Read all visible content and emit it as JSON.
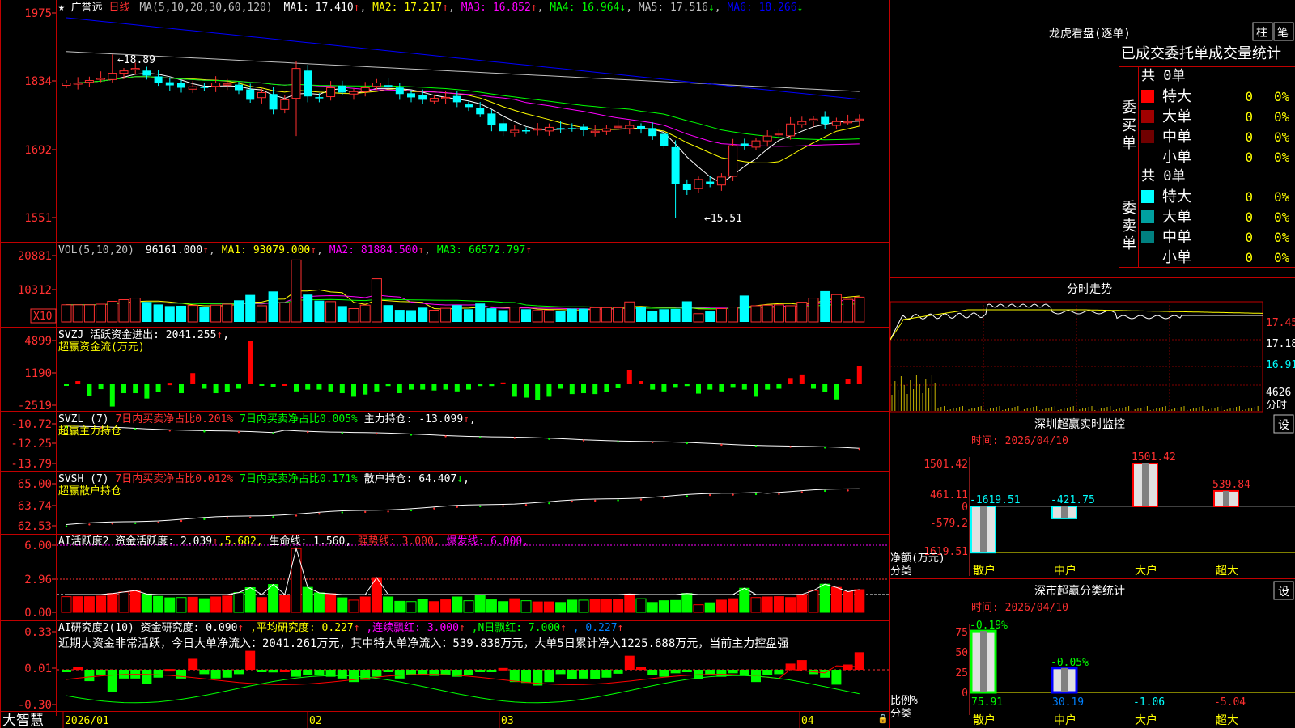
{
  "stock": {
    "star": "★",
    "name": "广誉远",
    "period": "日线"
  },
  "panels": {
    "price": {
      "yticks": [
        "1975",
        "1834",
        "1692",
        "1551"
      ],
      "ma_label": "MA(5,10,20,30,60,120)",
      "ma": [
        {
          "label": "MA1: 17.410",
          "arrow": "↑",
          "color": "#ffffff"
        },
        {
          "label": "MA2: 17.217",
          "arrow": "↑",
          "color": "#ffff00"
        },
        {
          "label": "MA3: 16.852",
          "arrow": "↑",
          "color": "#ff00ff"
        },
        {
          "label": "MA4: 16.964",
          "arrow": "↓",
          "color": "#00ff00"
        },
        {
          "label": "MA5: 17.516",
          "arrow": "↓",
          "color": "#c0c0c0"
        },
        {
          "label": "MA6: 18.266",
          "arrow": "↓",
          "color": "#0000ff"
        }
      ],
      "high_label": "←18.89",
      "low_label": "←15.51"
    },
    "vol": {
      "yticks": [
        "20881",
        "10312"
      ],
      "unit": "X10",
      "label": "VOL(5,10,20)",
      "value": "96161.000",
      "value_arrow": "↑",
      "ma": [
        {
          "label": "MA1: 93079.000",
          "arrow": "↑",
          "color": "#ffff00"
        },
        {
          "label": "MA2: 81884.500",
          "arrow": "↑",
          "color": "#ff00ff"
        },
        {
          "label": "MA3: 66572.797",
          "arrow": "↑",
          "color": "#00ff00"
        }
      ]
    },
    "svzj": {
      "yticks": [
        "4899",
        "1190",
        "-2519"
      ],
      "line1": "SVZJ  活跃资金进出: 2041.255",
      "line1_arrow": "↑",
      "line1_tail": ",",
      "line2": "超赢资金流(万元)"
    },
    "svzl": {
      "yticks": [
        "-10.72",
        "-12.25",
        "-13.79"
      ],
      "name": "SVZL (7)",
      "seg1": "7日内买卖净占比0.201%",
      "seg2": "7日内买卖净占比0.005%",
      "seg3": "主力持仓: -13.099",
      "seg3_arrow": "↑",
      "tail": ",",
      "line2": "超赢主力持仓"
    },
    "svsh": {
      "yticks": [
        "65.00",
        "63.74",
        "62.53"
      ],
      "name": "SVSH (7)",
      "seg1": "7日内买卖净占比0.012%",
      "seg2": "7日内买卖净占比0.171%",
      "seg3": "散户持仓: 64.407",
      "seg3_arrow": "↓",
      "tail": ",",
      "line2": "超赢散户持仓"
    },
    "ai1": {
      "yticks": [
        "6.00",
        "2.96",
        "0.00"
      ],
      "seg1": "AI活跃度2 资金活跃度: 2.039",
      "seg1_arrow": "↑",
      "seg2": ",5.682,",
      "seg3": "生命线: 1.560,",
      "seg4": "强势线: 3.000,",
      "seg5": "爆发线: 6.000,"
    },
    "ai2": {
      "yticks": [
        "0.33",
        "0.01",
        "-0.30"
      ],
      "seg1": "AI研究度2(10) 资金研究度: 0.090",
      "seg1_arrow": "↑",
      "seg2": ",平均研究度: 0.227",
      "seg2_arrow": "↑",
      "seg3": ",连续飘红: 3.000",
      "seg3_arrow": "↑",
      "seg4": ",N日飘红: 7.000",
      "seg4_arrow": "↑",
      "seg5": ", 0.227",
      "seg5_arrow": "↑",
      "comment": "近期大资金非常活跃，今日大单净流入：2041.261万元，其中特大单净流入：539.838万元，大单5日累计净入1225.688万元，当前主力控盘强"
    }
  },
  "xaxis": {
    "brand": "大智慧",
    "labels": [
      "2026/01",
      "02",
      "03",
      "04"
    ]
  },
  "side": {
    "longhu": {
      "title": "龙虎看盘(逐单)",
      "btn_zhu": "柱",
      "btn_bi": "笔",
      "subtitle": "已成交委托单成交量统计",
      "buy": {
        "label": "委买单",
        "total": "共 0单",
        "rows": [
          {
            "name": "特大",
            "val": "0",
            "pct": "0%",
            "color": "#ff0000"
          },
          {
            "name": "大单",
            "val": "0",
            "pct": "0%",
            "color": "#a00000"
          },
          {
            "name": "中单",
            "val": "0",
            "pct": "0%",
            "color": "#700000"
          },
          {
            "name": "小单",
            "val": "0",
            "pct": "0%",
            "color": ""
          }
        ]
      },
      "sell": {
        "label": "委卖单",
        "total": "共 0单",
        "rows": [
          {
            "name": "特大",
            "val": "0",
            "pct": "0%",
            "color": "#00ffff"
          },
          {
            "name": "大单",
            "val": "0",
            "pct": "0%",
            "color": "#00a0a0"
          },
          {
            "name": "中单",
            "val": "0",
            "pct": "0%",
            "color": "#008080"
          },
          {
            "name": "小单",
            "val": "0",
            "pct": "0%",
            "color": ""
          }
        ]
      }
    },
    "intraday": {
      "title": "分时走势",
      "yticks": [
        "17.45",
        "17.18",
        "16.91"
      ],
      "vol_tick": "4626",
      "vol_label": "分时"
    },
    "sz_monitor": {
      "title": "深圳超赢实时监控",
      "settings": "设",
      "time": "时间: 2026/04/10",
      "yticks": [
        "1501.42",
        "461.11",
        "0",
        "-579.2",
        "-1619.51"
      ],
      "ylabel1": "净额(万元)",
      "ylabel2": "分类",
      "categories": [
        "散户",
        "中户",
        "大户",
        "超大"
      ],
      "values": [
        "-1619.51",
        "-421.75",
        "1501.42",
        "539.84"
      ]
    },
    "sz_stats": {
      "title": "深市超赢分类统计",
      "settings": "设",
      "time": "时间: 2026/04/10",
      "yticks": [
        "75",
        "50",
        "25",
        "0"
      ],
      "ylabel1": "比例%",
      "ylabel2": "分类",
      "categories": [
        "散户",
        "中户",
        "大户",
        "超大"
      ],
      "tops": [
        "-0.19%",
        "-0.05%",
        "",
        ""
      ],
      "values": [
        "75.91",
        "30.19",
        "-1.06",
        "-5.04"
      ]
    }
  },
  "chart_data": [
    {
      "type": "candlestick",
      "title": "广誉远 日线",
      "x_labels": [
        "2026/01",
        "02",
        "03",
        "04"
      ],
      "yticks": [
        19.75,
        18.34,
        16.92,
        15.51
      ],
      "high": 18.89,
      "low": 15.51,
      "close": [
        18.3,
        18.3,
        18.35,
        18.4,
        18.5,
        18.55,
        18.6,
        18.45,
        18.3,
        18.25,
        18.2,
        18.22,
        18.2,
        18.3,
        18.28,
        18.15,
        17.95,
        18.1,
        17.75,
        17.95,
        18.6,
        18.02,
        18.0,
        18.2,
        18.1,
        18.12,
        18.2,
        18.3,
        18.22,
        18.07,
        18.0,
        17.95,
        17.98,
        18.0,
        17.9,
        17.8,
        17.65,
        17.42,
        17.3,
        17.32,
        17.3,
        17.35,
        17.38,
        17.35,
        17.35,
        17.32,
        17.3,
        17.35,
        17.4,
        17.42,
        17.35,
        17.2,
        17.0,
        16.2,
        16.08,
        16.3,
        16.2,
        16.35,
        17.0,
        17.0,
        17.1,
        17.2,
        17.25,
        17.45,
        17.5,
        17.55,
        17.45,
        17.5,
        17.5,
        17.55
      ]
    },
    {
      "type": "bar",
      "title": "VOL(5,10,20)",
      "yticks": [
        20881,
        10312
      ],
      "values_x10": [
        5400,
        5400,
        5400,
        5600,
        6500,
        7000,
        7500,
        6300,
        5500,
        5000,
        5100,
        5200,
        4700,
        5300,
        5600,
        6800,
        8500,
        5100,
        9600,
        6000,
        19500,
        8600,
        6700,
        6400,
        5000,
        4200,
        5300,
        13600,
        5300,
        3800,
        3700,
        4500,
        3700,
        4300,
        5300,
        4000,
        5800,
        4300,
        3700,
        4700,
        4000,
        3600,
        3600,
        3400,
        4200,
        4200,
        4500,
        4500,
        4500,
        6300,
        4700,
        3400,
        4000,
        4100,
        6500,
        2600,
        3300,
        4200,
        4700,
        8300,
        5100,
        5300,
        5400,
        5100,
        6200,
        7500,
        9700,
        8600,
        7100,
        7800
      ]
    },
    {
      "type": "bar",
      "title": "超赢资金流(万元)",
      "yticks": [
        4899,
        1190,
        -2519
      ],
      "values": [
        -150,
        360,
        -1300,
        -550,
        -2500,
        -1000,
        -1000,
        -1600,
        -900,
        80,
        -1000,
        1250,
        -500,
        -1000,
        -900,
        -500,
        4899,
        -180,
        -300,
        0,
        -800,
        -600,
        -600,
        -800,
        -1000,
        -1400,
        -1150,
        -800,
        -200,
        -1000,
        -600,
        -600,
        -700,
        -600,
        -800,
        -600,
        -200,
        -200,
        200,
        -1400,
        -1500,
        -1800,
        -1400,
        -500,
        -1100,
        -1000,
        -1100,
        -900,
        -450,
        1600,
        360,
        -600,
        -800,
        -400,
        -200,
        -1050,
        -600,
        -800,
        -400,
        -600,
        -1400,
        -600,
        -500,
        700,
        1100,
        -500,
        -900,
        -1700,
        600,
        2000
      ]
    }
  ]
}
